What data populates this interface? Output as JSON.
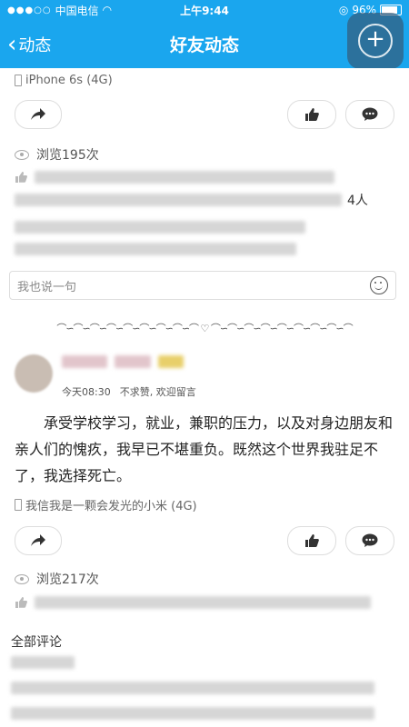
{
  "status_bar": {
    "carrier": "中国电信",
    "time": "上午9:44",
    "battery": "96%"
  },
  "nav": {
    "back_label": "动态",
    "title": "好友动态"
  },
  "post1": {
    "device": "iPhone 6s (4G)",
    "views": "浏览195次",
    "likes_count": "4人",
    "comment_placeholder": "我也说一句"
  },
  "divider": {
    "text": "⌒∽⌒∽⌒∽⌒∽⌒∽⌒∽⌒∽⌒∽⌒ ♡ ⌒∽⌒∽⌒∽⌒∽⌒∽⌒∽⌒∽⌒∽⌒"
  },
  "post2": {
    "time": "今天08:30",
    "privacy": "不求赞, 欢迎留言",
    "text": "承受学校学习，就业，兼职的压力，以及对身边朋友和亲人们的愧疚，我早已不堪重负。既然这个世界我驻足不了，我选择死亡。",
    "device": "我信我是一颗会发光的小米 (4G)",
    "views": "浏览217次",
    "comments_title": "全部评论"
  }
}
